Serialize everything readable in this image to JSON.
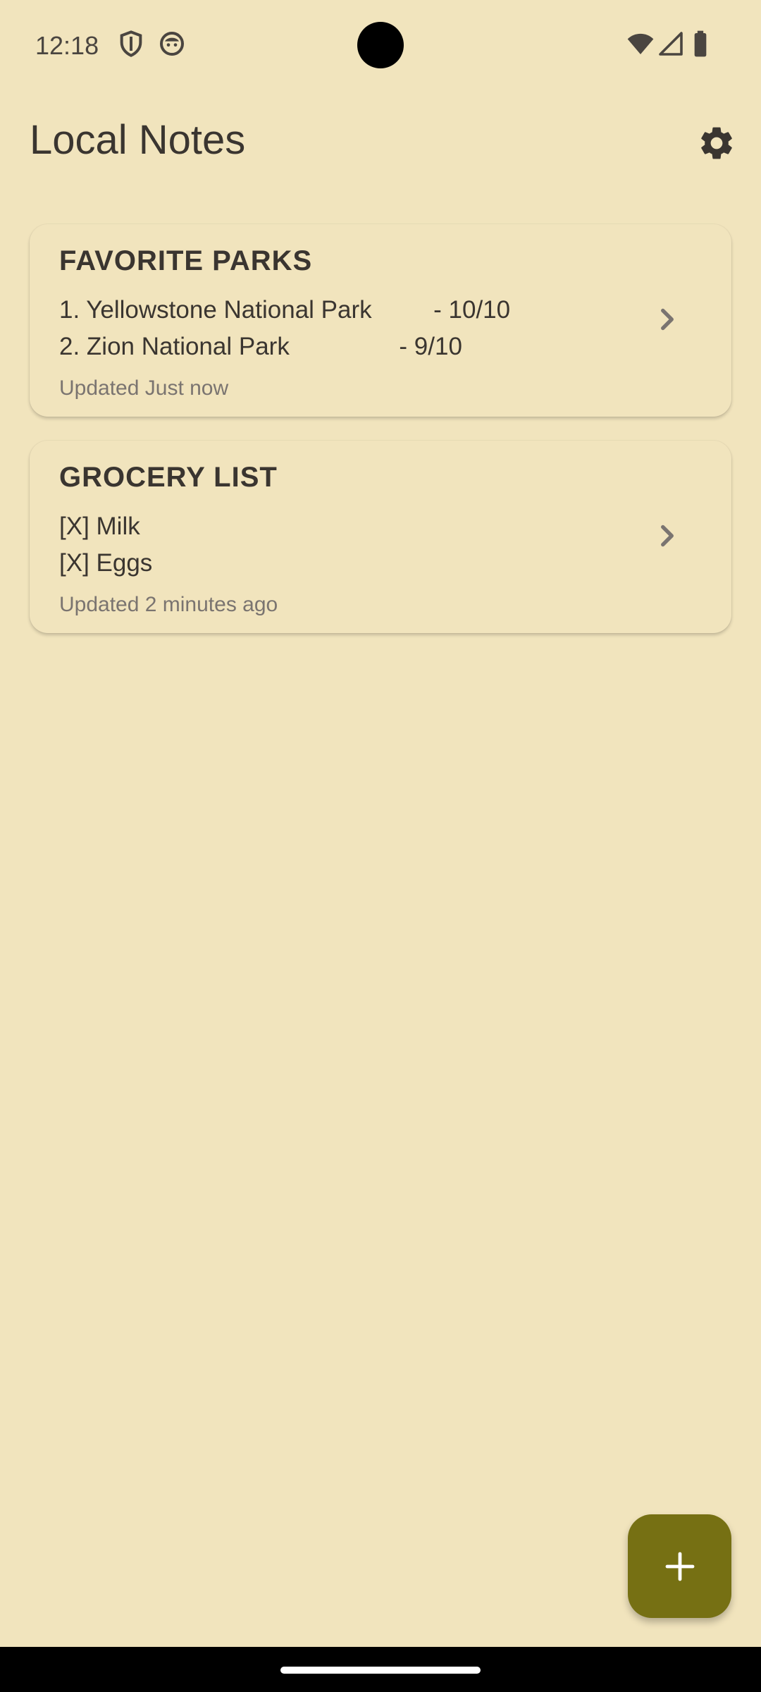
{
  "status_bar": {
    "time": "12:18",
    "left_icons": [
      "shield-icon",
      "face-icon"
    ],
    "right_icons": [
      "wifi-icon",
      "signal-icon",
      "battery-icon"
    ]
  },
  "header": {
    "title": "Local Notes",
    "settings_icon": "gear-icon"
  },
  "notes": [
    {
      "title": "FAVORITE PARKS",
      "lines": [
        "1. Yellowstone National Park         - 10/10",
        "2. Zion National Park                - 9/10"
      ],
      "updated": "Updated Just now"
    },
    {
      "title": "GROCERY LIST",
      "lines": [
        "[X] Milk",
        "[X] Eggs"
      ],
      "updated": "Updated 2 minutes ago"
    }
  ],
  "fab": {
    "icon": "plus-icon"
  },
  "colors": {
    "background": "#f1e4bd",
    "fab": "#767013",
    "text": "#3a3530",
    "muted": "#7a7470"
  }
}
